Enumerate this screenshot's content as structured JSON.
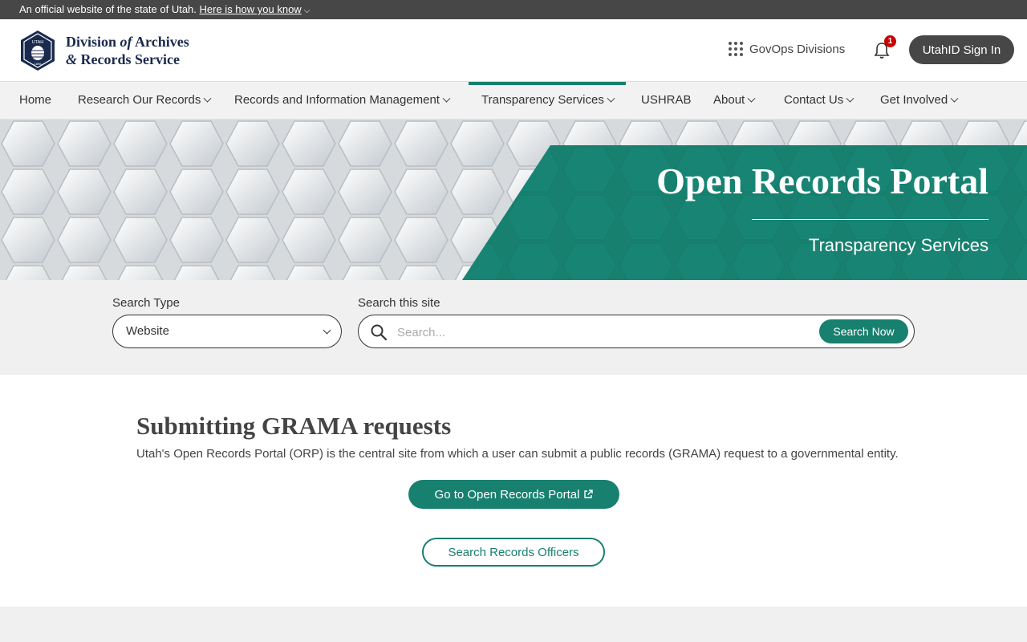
{
  "official_bar": {
    "text": "An official website of the state of Utah.",
    "link": "Here is how you know"
  },
  "header": {
    "logo": {
      "line1_a": "Division ",
      "line1_b": "of",
      "line1_c": " Archives",
      "line2_a": "&",
      "line2_b": " Records Service",
      "seal_top": "UTAH",
      "seal_year": "1896"
    },
    "govops_label": "GovOps Divisions",
    "notification_count": "1",
    "signin_label": "UtahID Sign In"
  },
  "nav": {
    "items": [
      {
        "label": "Home"
      },
      {
        "label": "Research Our Records"
      },
      {
        "label": "Records and Information Management"
      },
      {
        "label": "Transparency Services"
      },
      {
        "label": "USHRAB"
      },
      {
        "label": "About"
      },
      {
        "label": "Contact Us"
      },
      {
        "label": "Get Involved"
      }
    ]
  },
  "hero": {
    "title": "Open Records Portal",
    "subtitle": "Transparency Services"
  },
  "search": {
    "type_label": "Search Type",
    "type_value": "Website",
    "site_label": "Search this site",
    "placeholder": "Search...",
    "button_label": "Search Now"
  },
  "main": {
    "heading": "Submitting GRAMA requests",
    "description": "Utah's Open Records Portal (ORP) is the central site from which a user can submit a public records (GRAMA) request to a governmental entity.",
    "primary_button": "Go to Open Records Portal",
    "secondary_button": "Search Records Officers"
  },
  "colors": {
    "accent": "#17806f",
    "dark": "#474747",
    "navy": "#1a2a4e"
  }
}
